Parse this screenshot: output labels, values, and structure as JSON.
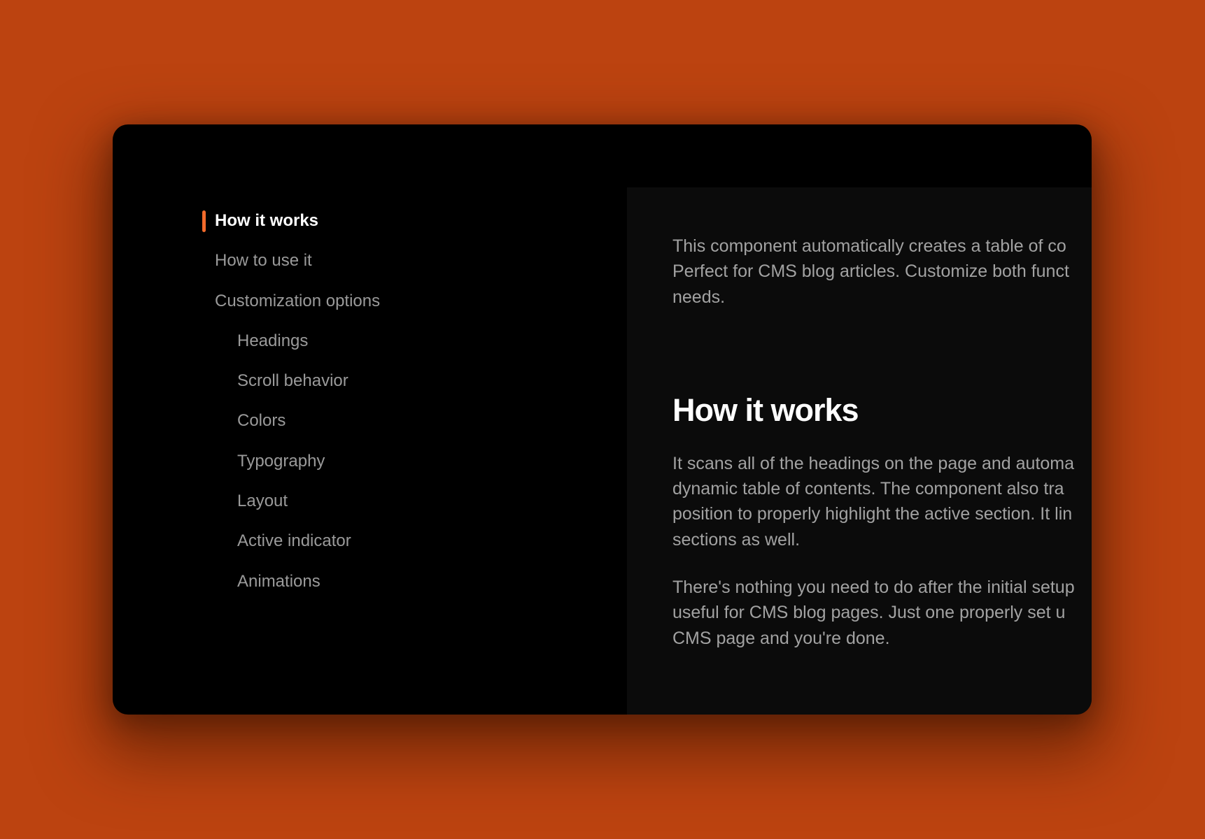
{
  "toc": {
    "items": [
      {
        "label": "How it works",
        "active": true,
        "level": 1
      },
      {
        "label": "How to use it",
        "active": false,
        "level": 1
      },
      {
        "label": "Customization options",
        "active": false,
        "level": 1
      },
      {
        "label": "Headings",
        "active": false,
        "level": 2
      },
      {
        "label": "Scroll behavior",
        "active": false,
        "level": 2
      },
      {
        "label": "Colors",
        "active": false,
        "level": 2
      },
      {
        "label": "Typography",
        "active": false,
        "level": 2
      },
      {
        "label": "Layout",
        "active": false,
        "level": 2
      },
      {
        "label": "Active indicator",
        "active": false,
        "level": 2
      },
      {
        "label": "Animations",
        "active": false,
        "level": 2
      }
    ]
  },
  "content": {
    "intro": {
      "lines": [
        "This component automatically creates a table of co",
        "Perfect for CMS blog articles. Customize both funct",
        "needs."
      ]
    },
    "section_heading": "How it works",
    "paragraph1": {
      "lines": [
        "It scans all of the headings on the page and automa",
        "dynamic table of contents. The component also tra",
        "position to properly highlight the active section. It lin",
        "sections as well."
      ]
    },
    "paragraph2": {
      "lines": [
        "There's nothing you need to do after the initial setup",
        "useful for CMS blog pages. Just one properly set u",
        "CMS page and you're done."
      ]
    }
  },
  "colors": {
    "background": "#bc4310",
    "window": "#000000",
    "content_panel": "#0b0b0b",
    "accent": "#f26a2b",
    "active_text": "#ffffff",
    "muted_text": "#9a9a9a"
  }
}
